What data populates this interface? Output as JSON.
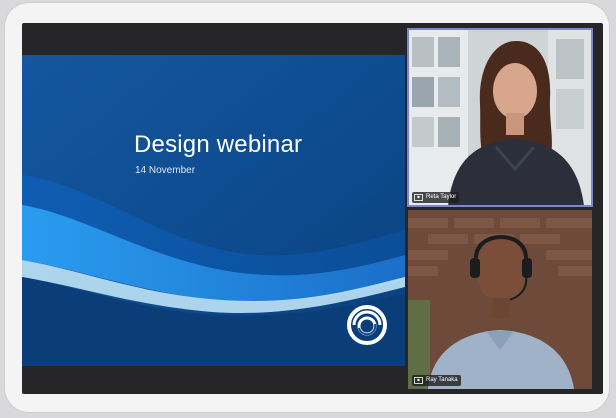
{
  "presentation": {
    "title": "Design webinar",
    "date": "14 November"
  },
  "participants": [
    {
      "name": "Reta Taylor",
      "active_speaker": true
    },
    {
      "name": "Ray Tanaka",
      "active_speaker": false
    }
  ],
  "colors": {
    "slide_bg": "#0f4d92",
    "slide_wave": "#1f8fe0",
    "stage_bg": "#262628",
    "active_outline": "#7d86c9"
  },
  "icons": {
    "slide_logo": "ring-logo-icon",
    "participant_tag": "person-tag-icon"
  }
}
